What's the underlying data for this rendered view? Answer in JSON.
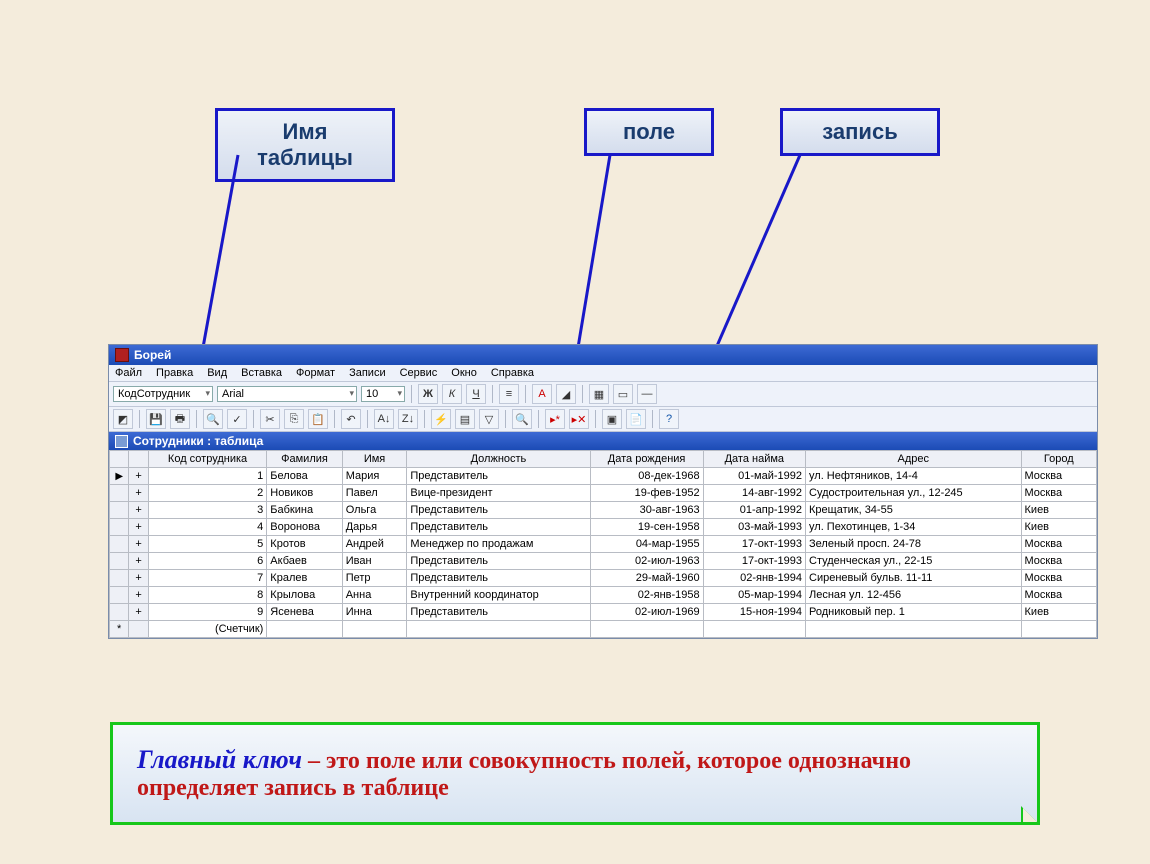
{
  "labels": {
    "table_name": "Имя таблицы",
    "field": "поле",
    "record": "запись"
  },
  "app_title": "Борей",
  "menu": [
    "Файл",
    "Правка",
    "Вид",
    "Вставка",
    "Формат",
    "Записи",
    "Сервис",
    "Окно",
    "Справка"
  ],
  "toolbar1": {
    "field_combo": "КодСотрудник",
    "font_combo": "Arial",
    "size_combo": "10"
  },
  "sub_title": "Сотрудники : таблица",
  "columns": [
    "",
    "",
    "Код сотрудника",
    "Фамилия",
    "Имя",
    "Должность",
    "Дата рождения",
    "Дата найма",
    "Адрес",
    "Город"
  ],
  "rows": [
    {
      "id": "1",
      "fam": "Белова",
      "name": "Мария",
      "pos": "Представитель",
      "dob": "08-дек-1968",
      "hire": "01-май-1992",
      "addr": "ул. Нефтяников, 14-4",
      "city": "Москва"
    },
    {
      "id": "2",
      "fam": "Новиков",
      "name": "Павел",
      "pos": "Вице-президент",
      "dob": "19-фев-1952",
      "hire": "14-авг-1992",
      "addr": "Судостроительная ул., 12-245",
      "city": "Москва"
    },
    {
      "id": "3",
      "fam": "Бабкина",
      "name": "Ольга",
      "pos": "Представитель",
      "dob": "30-авг-1963",
      "hire": "01-апр-1992",
      "addr": "Крещатик, 34-55",
      "city": "Киев"
    },
    {
      "id": "4",
      "fam": "Воронова",
      "name": "Дарья",
      "pos": "Представитель",
      "dob": "19-сен-1958",
      "hire": "03-май-1993",
      "addr": "ул. Пехотинцев, 1-34",
      "city": "Киев"
    },
    {
      "id": "5",
      "fam": "Кротов",
      "name": "Андрей",
      "pos": "Менеджер по продажам",
      "dob": "04-мар-1955",
      "hire": "17-окт-1993",
      "addr": "Зеленый просп. 24-78",
      "city": "Москва"
    },
    {
      "id": "6",
      "fam": "Акбаев",
      "name": "Иван",
      "pos": "Представитель",
      "dob": "02-июл-1963",
      "hire": "17-окт-1993",
      "addr": "Студенческая ул., 22-15",
      "city": "Москва"
    },
    {
      "id": "7",
      "fam": "Кралев",
      "name": "Петр",
      "pos": "Представитель",
      "dob": "29-май-1960",
      "hire": "02-янв-1994",
      "addr": "Сиреневый бульв. 11-11",
      "city": "Москва"
    },
    {
      "id": "8",
      "fam": "Крылова",
      "name": "Анна",
      "pos": "Внутренний координатор",
      "dob": "02-янв-1958",
      "hire": "05-мар-1994",
      "addr": "Лесная ул. 12-456",
      "city": "Москва"
    },
    {
      "id": "9",
      "fam": "Ясенева",
      "name": "Инна",
      "pos": "Представитель",
      "dob": "02-июл-1969",
      "hire": "15-ноя-1994",
      "addr": "Родниковый пер. 1",
      "city": "Киев"
    }
  ],
  "new_row_label": "(Счетчик)",
  "definition": {
    "key": "Главный ключ",
    "dash": " – ",
    "text": "это поле или совокупность полей, которое однозначно определяет запись в таблице"
  }
}
